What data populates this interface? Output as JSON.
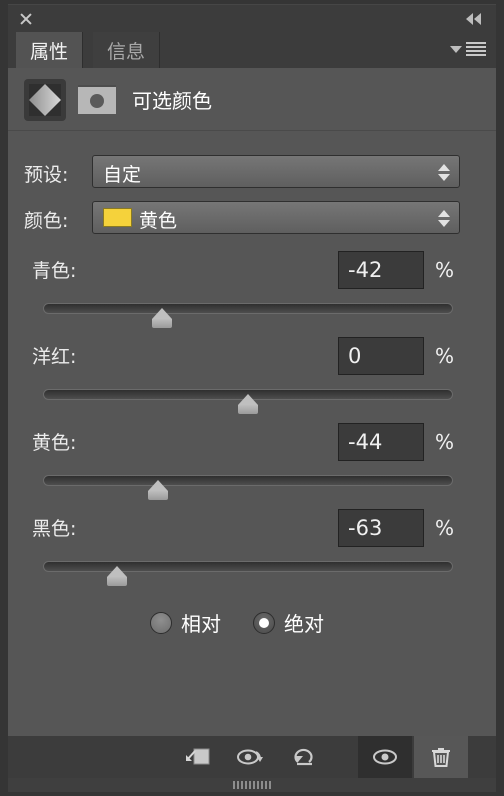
{
  "window": {
    "close_icon": "close-icon",
    "collapse_icon": "double-chevron-left-icon",
    "panel_menu_icon": "panel-menu-icon"
  },
  "tabs": [
    {
      "label": "属性",
      "active": true
    },
    {
      "label": "信息",
      "active": false
    }
  ],
  "adjustment": {
    "title": "可选颜色",
    "layer_thumbnail_icon": "adjustment-layer-thumbnail-icon",
    "mask_thumbnail_icon": "layer-mask-thumbnail-icon"
  },
  "fields": {
    "preset": {
      "label": "预设:",
      "value": "自定"
    },
    "color": {
      "label": "颜色:",
      "value": "黄色",
      "swatch_hex": "#f5d23b"
    }
  },
  "sliders": [
    {
      "label": "青色:",
      "value": "-42",
      "unit": "%",
      "position_pct": 29
    },
    {
      "label": "洋红:",
      "value": "0",
      "unit": "%",
      "position_pct": 50
    },
    {
      "label": "黄色:",
      "value": "-44",
      "unit": "%",
      "position_pct": 28
    },
    {
      "label": "黑色:",
      "value": "-63",
      "unit": "%",
      "position_pct": 18
    }
  ],
  "method": {
    "options": [
      {
        "label": "相对",
        "checked": false
      },
      {
        "label": "绝对",
        "checked": true
      }
    ]
  },
  "footer": {
    "tools": [
      {
        "name": "clip-to-layer-icon",
        "state": "normal"
      },
      {
        "name": "view-previous-state-icon",
        "state": "normal"
      },
      {
        "name": "reset-icon",
        "state": "normal"
      },
      {
        "name": "toggle-visibility-icon",
        "state": "pressed"
      },
      {
        "name": "delete-icon",
        "state": "hover"
      }
    ]
  }
}
